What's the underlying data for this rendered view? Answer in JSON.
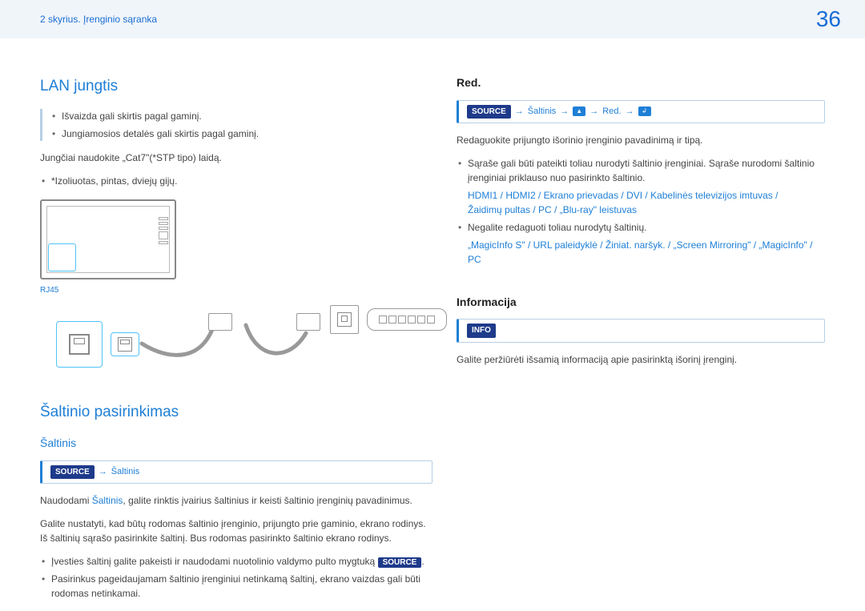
{
  "header": {
    "breadcrumb": "2 skyrius. Įrenginio sąranka",
    "page": "36"
  },
  "left": {
    "h_lan": "LAN jungtis",
    "note1": "Išvaizda gali skirtis pagal gaminį.",
    "note2": "Jungiamosios detalės gali skirtis pagal gaminį.",
    "cable_instr": "Jungčiai naudokite „Cat7\"(*STP tipo) laidą.",
    "cable_note": "*Izoliuotas, pintas, dviejų gijų.",
    "rj45": "RJ45",
    "h_source_sel": "Šaltinio pasirinkimas",
    "h_source": "Šaltinis",
    "src_badge": "SOURCE",
    "src_path": "Šaltinis",
    "p1a": "Naudodami ",
    "p1b": "Šaltinis",
    "p1c": ", galite rinktis įvairius šaltinius ir keisti šaltinio įrenginių pavadinimus.",
    "p2": "Galite nustatyti, kad būtų rodomas šaltinio įrenginio, prijungto prie gaminio, ekrano rodinys. Iš šaltinių sąrašo pasirinkite šaltinį. Bus rodomas pasirinkto šaltinio ekrano rodinys.",
    "bl1a": "Įvesties šaltinį galite pakeisti ir naudodami nuotolinio valdymo pulto mygtuką ",
    "bl1b": ".",
    "bl2": "Pasirinkus pageidaujamam šaltinio įrenginiui netinkamą šaltinį, ekrano vaizdas gali būti rodomas netinkamai."
  },
  "right": {
    "h_red": "Red.",
    "red_path_src": "Šaltinis",
    "red_path_red": "Red.",
    "p_red": "Redaguokite prijungto išorinio įrenginio pavadinimą ir tipą.",
    "bl_r1": "Sąraše gali būti pateikti toliau nurodyti šaltinio įrenginiai. Sąraše nurodomi šaltinio įrenginiai priklauso nuo pasirinkto šaltinio.",
    "srclist1": "HDMI1  / HDMI2  / Ekrano prievadas  / DVI  / Kabelinės televizijos imtuvas  /",
    "srclist2": "Žaidimų pultas  / PC  / „Blu-ray\" leistuvas",
    "bl_r2": "Negalite redaguoti toliau nurodytų šaltinių.",
    "nored": "„MagicInfo S\"  / URL paleidyklė  / Žiniat. naršyk.  / „Screen Mirroring\"  / „MagicInfo\"  / PC",
    "h_info": "Informacija",
    "info_badge": "INFO",
    "p_info": "Galite peržiūrėti išsamią informaciją apie pasirinktą išorinį įrenginį."
  }
}
